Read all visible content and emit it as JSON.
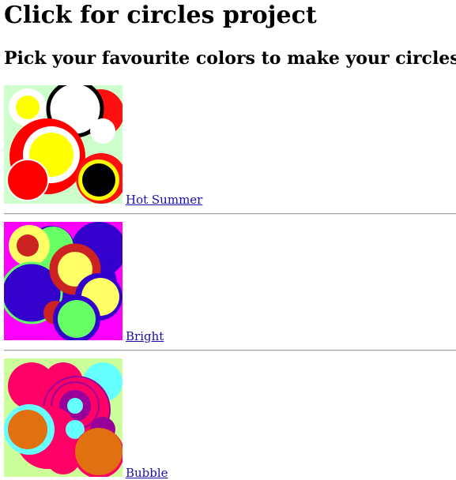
{
  "page": {
    "title": "Click for circles project",
    "subtitle": "Pick your favourite colors to make your circles"
  },
  "projects": [
    {
      "link_label": "Hot Summer",
      "thumbnail_description": "circles in yellow, red, black and white",
      "colors": {
        "background": "#ccffcc",
        "palette": [
          "#ffff00",
          "#ff0000",
          "#000000",
          "#ffffff"
        ]
      }
    },
    {
      "link_label": "Bright",
      "thumbnail_description": "circles in purple, green, yellow and red",
      "colors": {
        "background": "#ff00ff",
        "palette": [
          "#3300cc",
          "#66ff66",
          "#ffff66",
          "#cc2222"
        ]
      }
    },
    {
      "link_label": "Bubble",
      "thumbnail_description": "circles in pink, cyan, orange and purple",
      "colors": {
        "background": "#ccff99",
        "palette": [
          "#ff0066",
          "#66ffff",
          "#e07010",
          "#990099"
        ]
      }
    }
  ]
}
